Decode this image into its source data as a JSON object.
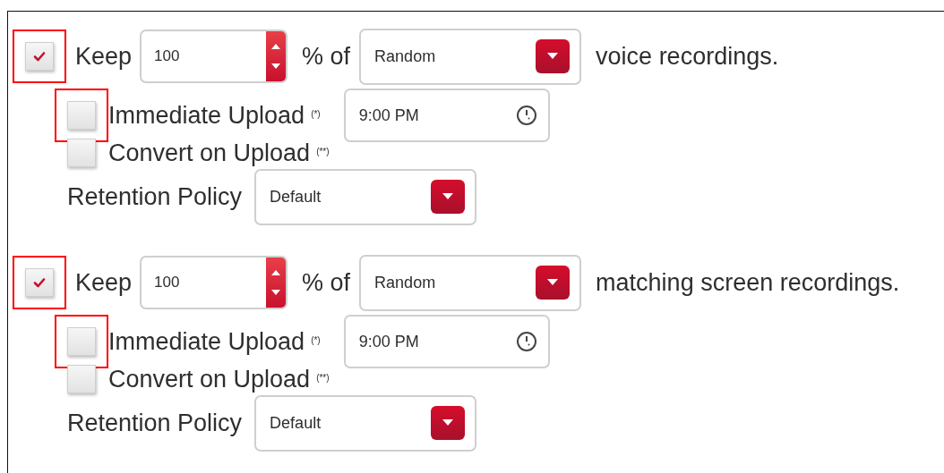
{
  "sections": [
    {
      "keep": {
        "checked": true,
        "highlighted": true,
        "label": "Keep"
      },
      "percent": "100",
      "of_label": "% of",
      "sample": "Random",
      "suffix": "voice recordings.",
      "immediate_upload": {
        "checked": false,
        "highlighted": true,
        "label": "Immediate Upload",
        "note": "(*)",
        "time": "9:00 PM"
      },
      "convert_on_upload": {
        "checked": false,
        "highlighted": false,
        "label": "Convert on Upload",
        "note": "(**)"
      },
      "retention_policy": {
        "label": "Retention Policy",
        "value": "Default"
      }
    },
    {
      "keep": {
        "checked": true,
        "highlighted": true,
        "label": "Keep"
      },
      "percent": "100",
      "of_label": "% of",
      "sample": "Random",
      "suffix": "matching screen recordings.",
      "immediate_upload": {
        "checked": false,
        "highlighted": true,
        "label": "Immediate Upload",
        "note": "(*)",
        "time": "9:00 PM"
      },
      "convert_on_upload": {
        "checked": false,
        "highlighted": false,
        "label": "Convert on Upload",
        "note": "(**)"
      },
      "retention_policy": {
        "label": "Retention Policy",
        "value": "Default"
      }
    }
  ]
}
